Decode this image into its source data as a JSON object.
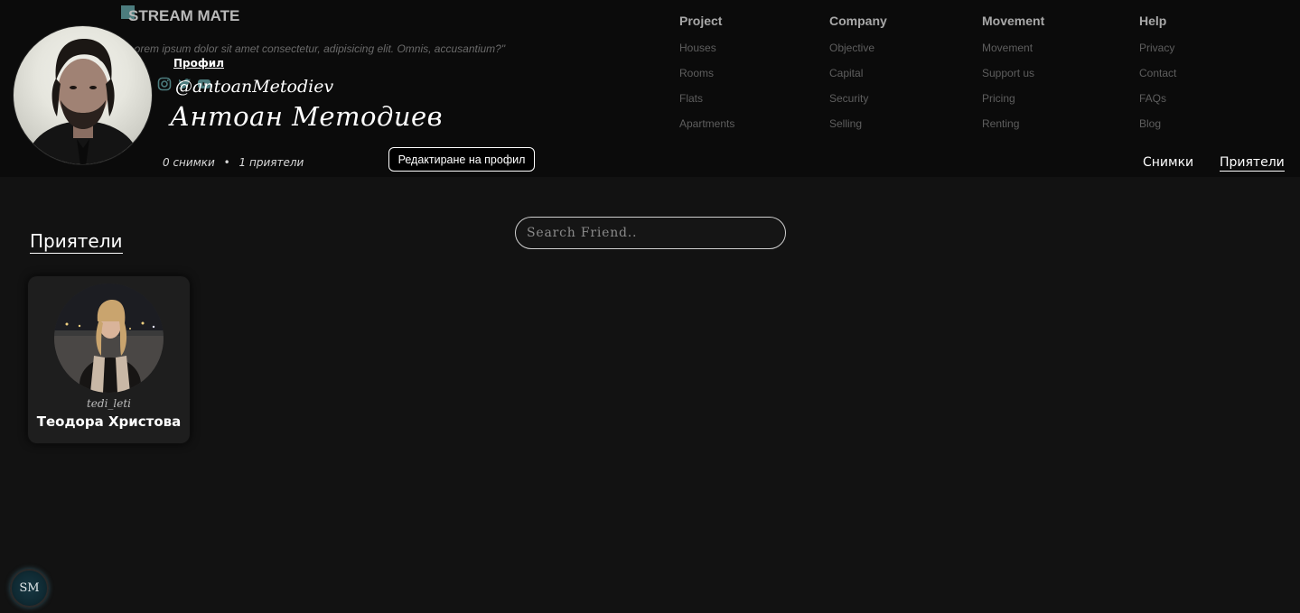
{
  "brand": {
    "name": "STREAM MATE",
    "tagline": "Lorem ipsum dolor sit amet consectetur, adipisicing elit. Omnis, accusantium?\""
  },
  "profile": {
    "link_label": "Профил",
    "handle": "@antoanMetodiev",
    "full_name": "Антоан Методиев",
    "photos_count": "0 снимки",
    "separator": "•",
    "friends_count": "1 приятели",
    "edit_button": "Редактиране на профил"
  },
  "footer_nav": {
    "columns": [
      {
        "title": "Project",
        "links": [
          "Houses",
          "Rooms",
          "Flats",
          "Apartments"
        ]
      },
      {
        "title": "Company",
        "links": [
          "Objective",
          "Capital",
          "Security",
          "Selling"
        ]
      },
      {
        "title": "Movement",
        "links": [
          "Movement",
          "Support us",
          "Pricing",
          "Renting"
        ]
      },
      {
        "title": "Help",
        "links": [
          "Privacy",
          "Contact",
          "FAQs",
          "Blog"
        ]
      }
    ]
  },
  "tabs": {
    "photos": "Снимки",
    "friends": "Приятели",
    "active": "friends"
  },
  "friends_section": {
    "title": "Приятели",
    "search_placeholder": "Search Friend..",
    "friends": [
      {
        "username": "tedi_leti",
        "name": "Теодора Христова"
      }
    ]
  },
  "badge": {
    "label": "SM"
  },
  "colors": {
    "background": "#121212",
    "header_bg": "#0b0b0b",
    "card_bg": "#1e1e1e",
    "accent_teal": "#4c7c7e"
  },
  "icons": [
    "instagram-icon",
    "twitter-icon",
    "youtube-icon"
  ]
}
